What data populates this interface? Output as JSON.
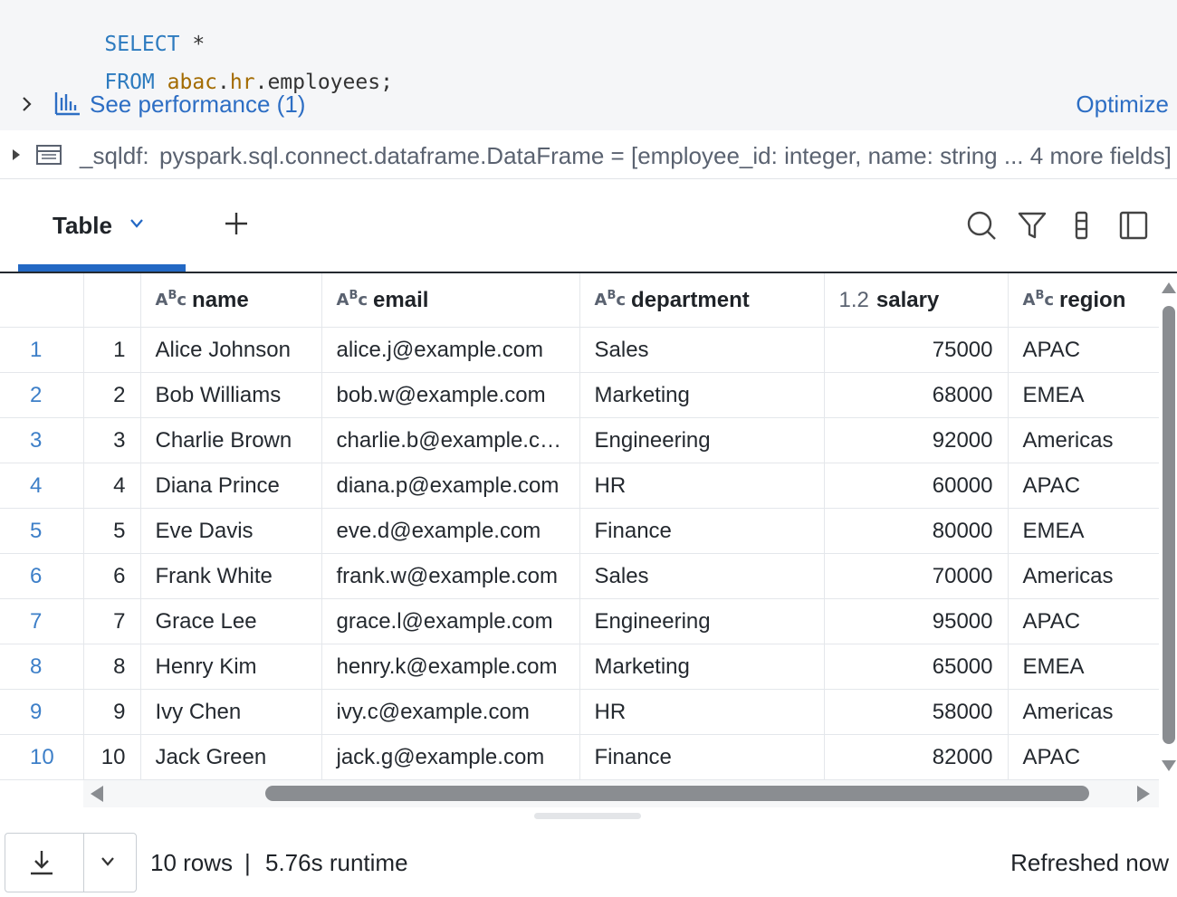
{
  "code": {
    "line1": {
      "kw": "SELECT",
      "rest": " *"
    },
    "line2": {
      "kw": "FROM",
      "schema": "abac",
      "dot1": ".",
      "db": "hr",
      "table": ".employees;"
    }
  },
  "performance": {
    "link_label": "See performance (1)",
    "optimize_label": "Optimize"
  },
  "dataframe": {
    "name": "_sqldf:",
    "type": "pyspark.sql.connect.dataframe.DataFrame = [employee_id: integer, name: string ... 4 more fields]"
  },
  "tabs": {
    "active_label": "Table"
  },
  "table": {
    "columns": [
      {
        "label": "name",
        "type": "ABC"
      },
      {
        "label": "email",
        "type": "ABC"
      },
      {
        "label": "department",
        "type": "ABC"
      },
      {
        "label": "salary",
        "type": "1.2"
      },
      {
        "label": "region",
        "type": "ABC"
      }
    ],
    "rows": [
      {
        "idx": "1",
        "id": "1",
        "name": "Alice Johnson",
        "email": "alice.j@example.com",
        "department": "Sales",
        "salary": "75000",
        "region": "APAC"
      },
      {
        "idx": "2",
        "id": "2",
        "name": "Bob Williams",
        "email": "bob.w@example.com",
        "department": "Marketing",
        "salary": "68000",
        "region": "EMEA"
      },
      {
        "idx": "3",
        "id": "3",
        "name": "Charlie Brown",
        "email": "charlie.b@example.co...",
        "department": "Engineering",
        "salary": "92000",
        "region": "Americas"
      },
      {
        "idx": "4",
        "id": "4",
        "name": "Diana Prince",
        "email": "diana.p@example.com",
        "department": "HR",
        "salary": "60000",
        "region": "APAC"
      },
      {
        "idx": "5",
        "id": "5",
        "name": "Eve Davis",
        "email": "eve.d@example.com",
        "department": "Finance",
        "salary": "80000",
        "region": "EMEA"
      },
      {
        "idx": "6",
        "id": "6",
        "name": "Frank White",
        "email": "frank.w@example.com",
        "department": "Sales",
        "salary": "70000",
        "region": "Americas"
      },
      {
        "idx": "7",
        "id": "7",
        "name": "Grace Lee",
        "email": "grace.l@example.com",
        "department": "Engineering",
        "salary": "95000",
        "region": "APAC"
      },
      {
        "idx": "8",
        "id": "8",
        "name": "Henry Kim",
        "email": "henry.k@example.com",
        "department": "Marketing",
        "salary": "65000",
        "region": "EMEA"
      },
      {
        "idx": "9",
        "id": "9",
        "name": "Ivy Chen",
        "email": "ivy.c@example.com",
        "department": "HR",
        "salary": "58000",
        "region": "Americas"
      },
      {
        "idx": "10",
        "id": "10",
        "name": "Jack Green",
        "email": "jack.g@example.com",
        "department": "Finance",
        "salary": "82000",
        "region": "APAC"
      }
    ]
  },
  "footer": {
    "rows": "10 rows",
    "separator": "|",
    "runtime": "5.76s runtime",
    "refreshed": "Refreshed now"
  },
  "icons": {
    "perf": "bar-chart-icon",
    "df": "table-icon",
    "search": "search-icon",
    "filter": "filter-icon",
    "columns": "columns-icon",
    "panel": "side-panel-icon",
    "download": "download-icon"
  }
}
